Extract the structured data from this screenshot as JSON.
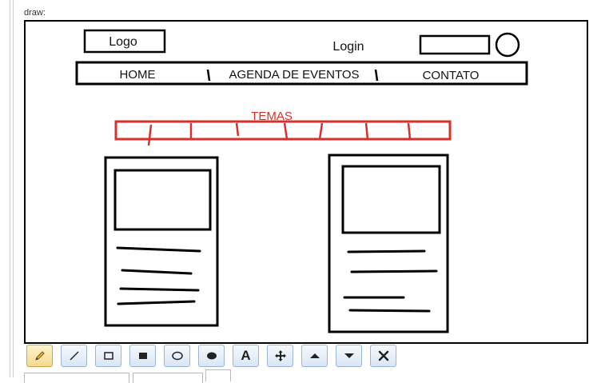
{
  "editor": {
    "label": "draw:"
  },
  "sketch": {
    "logo": "Logo",
    "login": "Login",
    "nav": [
      "HOME",
      "AGENDA DE EVENTOS",
      "CONTATO"
    ],
    "themes_label": "TEMAS",
    "themes_color": "#d9302c"
  },
  "toolbar": {
    "tools": [
      {
        "name": "pencil-icon",
        "active": true
      },
      {
        "name": "line-icon"
      },
      {
        "name": "rectangle-icon"
      },
      {
        "name": "filled-rectangle-icon"
      },
      {
        "name": "ellipse-icon"
      },
      {
        "name": "filled-ellipse-icon"
      },
      {
        "name": "text-icon",
        "glyph": "A"
      },
      {
        "name": "move-icon"
      },
      {
        "name": "move-up-icon"
      },
      {
        "name": "move-down-icon"
      },
      {
        "name": "delete-icon"
      }
    ]
  }
}
